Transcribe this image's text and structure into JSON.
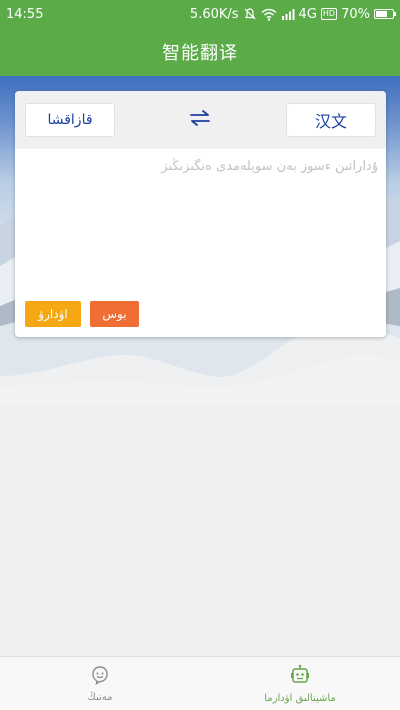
{
  "status": {
    "time": "14:55",
    "speed": "5.60K/s",
    "network": "4G",
    "hd": "HD",
    "battery": "70%",
    "battery_level": 0.7
  },
  "header": {
    "title": "智能翻译"
  },
  "translator": {
    "source_lang": "قازاقشا",
    "target_lang": "汉文",
    "swap_icon": "swap-arrows-icon",
    "input_value": "",
    "placeholder": "ۇداراتىن ءسوز بەن سويلەمدى ەنگىزىڭىز",
    "translate_label": "اۋدارۋ",
    "clear_label": "بوس"
  },
  "colors": {
    "accent": "#5bab49",
    "nav_active": "#6aa64f",
    "lang_text": "#1d3f9e",
    "translate_btn": "#f5a813",
    "clear_btn": "#f06e34"
  },
  "nav": {
    "items": [
      {
        "label": "مەنىڭ",
        "icon": "face-icon",
        "active": false
      },
      {
        "label": "ماشينالىق اۋدارما",
        "icon": "robot-icon",
        "active": true
      }
    ]
  }
}
